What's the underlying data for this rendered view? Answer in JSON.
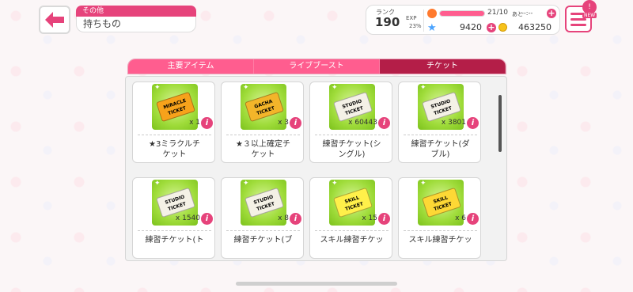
{
  "header": {
    "category": "その他",
    "title": "持ちもの"
  },
  "status": {
    "rank_label": "ランク",
    "rank": "190",
    "exp_label": "EXP",
    "exp_percent": "23%",
    "exp_progress": 0.23,
    "lp_text": "21/10",
    "lp_after": "あと",
    "lp_timer": "--:--",
    "lp_progress": 1.0,
    "jewels": "9420",
    "coins": "463250",
    "menu_badge": "!",
    "menu_new": "NEW"
  },
  "tabs": [
    {
      "label": "主要アイテム",
      "active": false
    },
    {
      "label": "ライブブースト",
      "active": false
    },
    {
      "label": "チケット",
      "active": true
    }
  ],
  "items": [
    {
      "ticket_text": "MIRACLE\nTICKET",
      "ticket_color": "#f7a21b",
      "qty": "x 1",
      "name": "★3ミラクルチ\nケット"
    },
    {
      "ticket_text": "GACHA\nTICKET",
      "ticket_color": "#f3b52a",
      "qty": "x 3",
      "name": "★３以上確定チ\nケット"
    },
    {
      "ticket_text": "STUDIO\nTICKET",
      "ticket_color": "#f4f1e6",
      "qty": "x 60443",
      "name": "練習チケット(シ\nングル)"
    },
    {
      "ticket_text": "STUDIO\nTICKET",
      "ticket_color": "#f4f1e6",
      "qty": "x 3801",
      "name": "練習チケット(ダ\nブル)"
    },
    {
      "ticket_text": "STUDIO\nTICKET",
      "ticket_color": "#f4f1e6",
      "qty": "x 1540",
      "name": "練習チケット(ト"
    },
    {
      "ticket_text": "STUDIO\nTICKET",
      "ticket_color": "#f4f1e6",
      "qty": "x 8",
      "name": "練習チケット(ブ"
    },
    {
      "ticket_text": "SKILL\nTICKET",
      "ticket_color": "#fff04a",
      "qty": "x 15",
      "name": "スキル練習チケッ"
    },
    {
      "ticket_text": "SKILL\nTICKET",
      "ticket_color": "#fdd835",
      "qty": "x 6",
      "name": "スキル練習チケッ"
    }
  ],
  "colors": {
    "accent": "#e6437b",
    "tab_active": "#b41e48",
    "tab_inactive": "#ff5d8f",
    "item_bg": "#9fdc3a"
  }
}
